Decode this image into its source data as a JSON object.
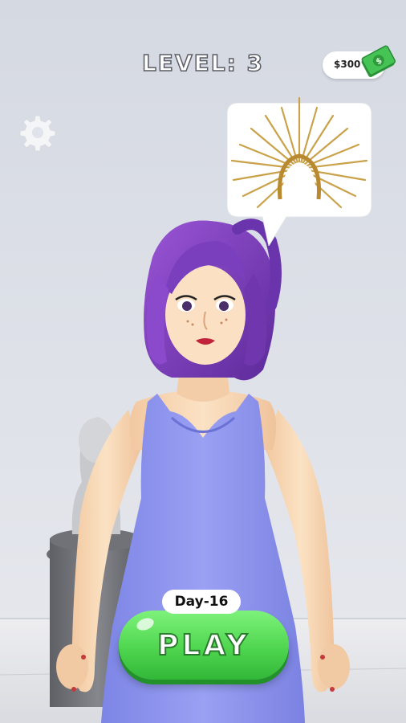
{
  "hud": {
    "level_text": "LEVEL: 3",
    "money": "$300",
    "money_icon": "cash-stack-icon",
    "settings_icon": "gear-icon"
  },
  "request_bubble": {
    "item_icon": "sunburst-headband-icon"
  },
  "play_area": {
    "day_label": "Day-16",
    "play_label": "PLAY"
  },
  "colors": {
    "play_button": "#4fd64f",
    "dress": "#8f96ef",
    "hair": "#7b3fbf",
    "background": "#dfe3ea",
    "money_bill": "#3fbf4f"
  }
}
